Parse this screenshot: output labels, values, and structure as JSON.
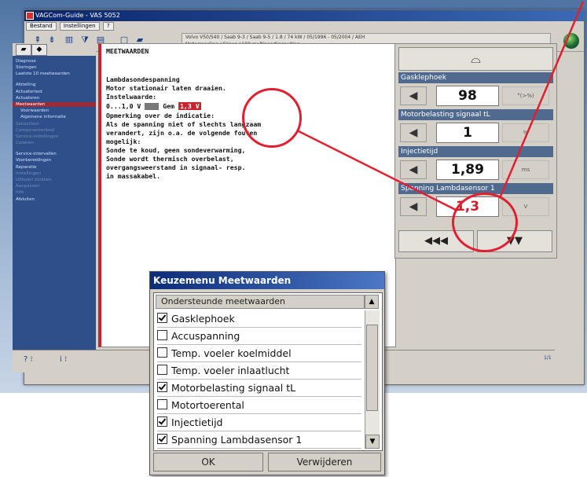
{
  "window": {
    "title": "VAGCom-Guide - VAS 5052"
  },
  "menu": {
    "items": [
      "Bestand",
      "Instellingen",
      "?"
    ]
  },
  "vehicle": {
    "line1": "Volvo V50/S40 / Saab 9-3 / Saab 9-5 / 1.8 / 74 kW / 05/1996 - 05/2004 / AEH",
    "line2": "Motorregeling / Simos / 100 multipoortinspuiting"
  },
  "sidebar": {
    "items": [
      {
        "label": "Diagnose",
        "state": "normal"
      },
      {
        "label": "Storingen",
        "state": "normal"
      },
      {
        "label": "Laatste 10 meetwaarden",
        "state": "normal"
      },
      {
        "label": "Afstelling",
        "state": "normal"
      },
      {
        "label": "Actuatortest",
        "state": "normal"
      },
      {
        "label": "Actuatoren",
        "state": "normal"
      },
      {
        "label": "Meetwaarden",
        "state": "selected"
      },
      {
        "label": "Voorwaarden",
        "state": "sub"
      },
      {
        "label": "Algemene informatie",
        "state": "sub"
      },
      {
        "label": "Sensortest",
        "state": "dim"
      },
      {
        "label": "Componententest",
        "state": "dim"
      },
      {
        "label": "Service-instellingen",
        "state": "dim"
      },
      {
        "label": "Coderen",
        "state": "dim"
      },
      {
        "label": "Service-intervallen",
        "state": "normal"
      },
      {
        "label": "Voorbereidingen",
        "state": "normal"
      },
      {
        "label": "Reparatie",
        "state": "normal"
      },
      {
        "label": "Instellingen",
        "state": "dim"
      },
      {
        "label": "Uitlezen blokken",
        "state": "dim"
      },
      {
        "label": "Aanpassen",
        "state": "dim"
      },
      {
        "label": "Info",
        "state": "dim"
      },
      {
        "label": "Afsluiten",
        "state": "normal"
      }
    ]
  },
  "content": {
    "title": "MEETWAARDEN",
    "heading": "Lambdasondespanning",
    "line2": "Motor stationair laten draaien.",
    "setpoint_label": "Instelwaarde:",
    "setpoint_range": "0...1,0 V",
    "measured_label": "Gem",
    "measured_value": "1,3 V",
    "note_heading": "Opmerking over de indicatie:",
    "lines": [
      "Als de spanning niet of slechts langzaam",
      "verandert, zijn o.a. de volgende fouten",
      "mogelijk:",
      "Sonde te koud, geen sondeverwarming,",
      "Sonde wordt thermisch overbelast,",
      "overgangsweerstand in signaal- resp.",
      "in massakabel."
    ]
  },
  "panel": {
    "rows": [
      {
        "label": "Gasklephoek",
        "value": "98",
        "unit": "°(>%)"
      },
      {
        "label": "Motorbelasting signaal tL",
        "value": "1",
        "unit": "%"
      },
      {
        "label": "Injectietijd",
        "value": "1,89",
        "unit": "ms"
      },
      {
        "label": "Spanning Lambdasensor 1",
        "value": "1,3",
        "unit": "V"
      }
    ],
    "nav_back": "◀◀◀",
    "nav_down": "▼▼"
  },
  "dialog": {
    "title": "Keuzemenu Meetwaarden",
    "header": "Ondersteunde meetwaarden",
    "items": [
      {
        "label": "Gasklephoek",
        "checked": true
      },
      {
        "label": "Accuspanning",
        "checked": false
      },
      {
        "label": "Temp. voeler koelmiddel",
        "checked": false
      },
      {
        "label": "Temp. voeler inlaatlucht",
        "checked": false
      },
      {
        "label": "Motorbelasting signaal tL",
        "checked": true
      },
      {
        "label": "Motortoerental",
        "checked": false
      },
      {
        "label": "Injectietijd",
        "checked": true
      },
      {
        "label": "Spanning Lambdasensor 1",
        "checked": true
      }
    ],
    "ok_label": "OK",
    "remove_label": "Verwijderen"
  },
  "statusbar": {
    "page": "1/1"
  },
  "colors": {
    "accent_red": "#e02030",
    "title_blue": "#0c2c78",
    "sidebar_blue": "#2e4f8a"
  }
}
